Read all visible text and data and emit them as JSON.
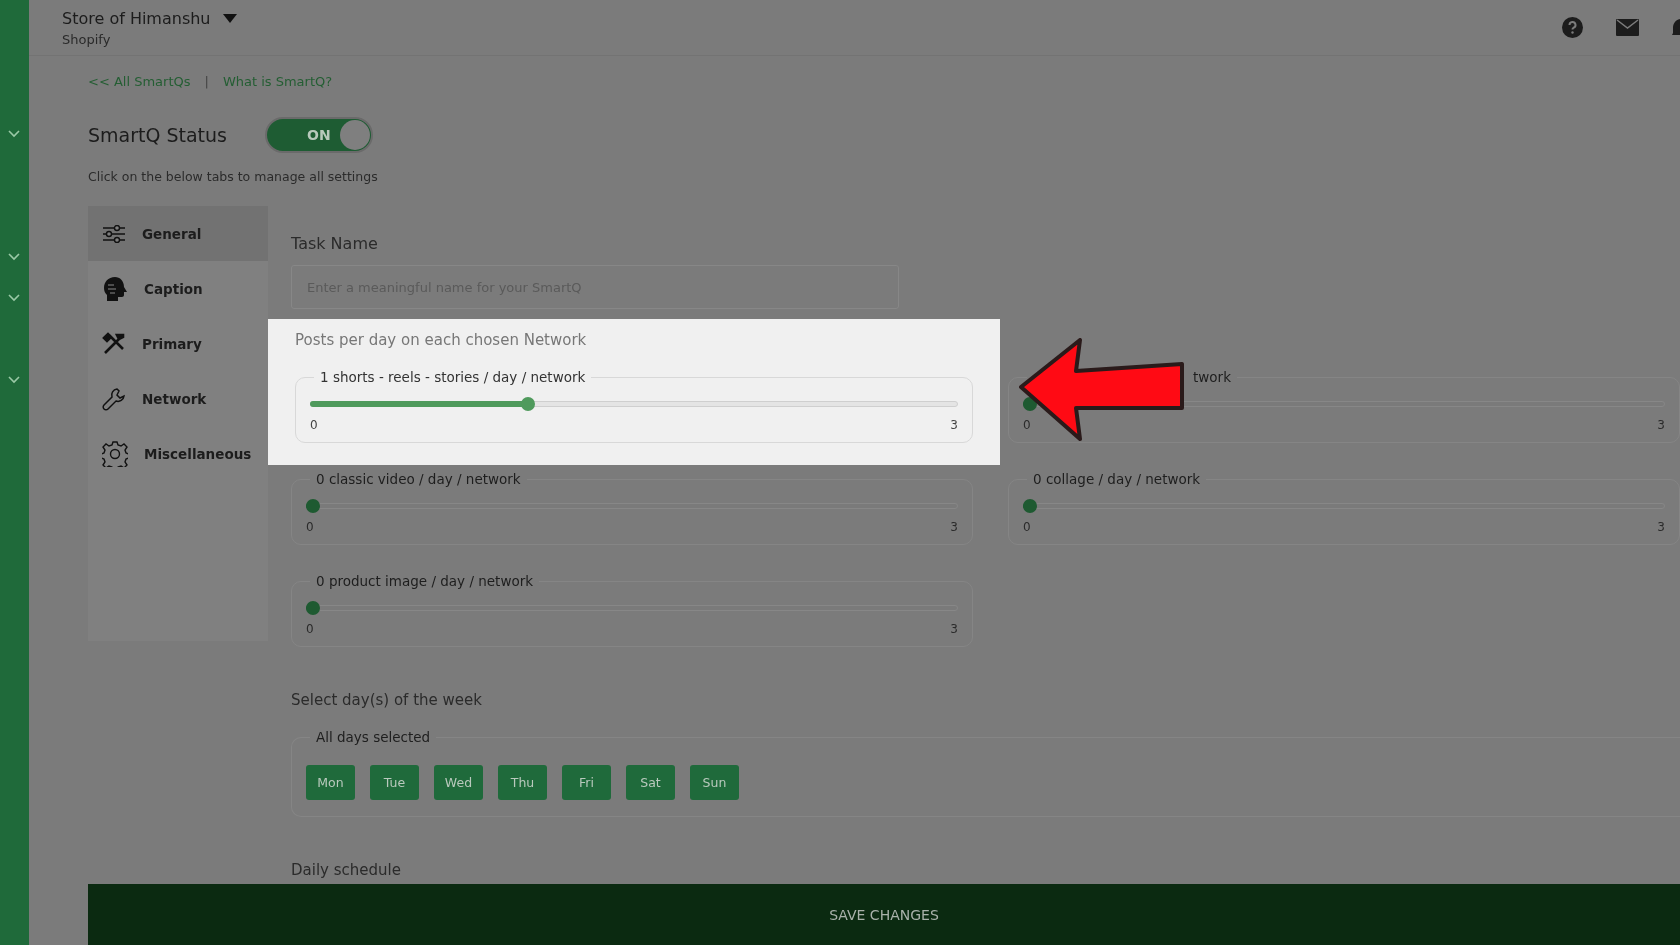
{
  "header": {
    "store": "Store of Himanshu",
    "platform": "Shopify"
  },
  "links": [
    "<< All SmartQs",
    "|",
    "What is SmartQ?"
  ],
  "status": {
    "label": "SmartQ Status",
    "toggle_text": "ON",
    "on": true
  },
  "hint": "Click on the below tabs to manage all settings",
  "menu": [
    {
      "label": "General",
      "kind": "sliders",
      "selected": true
    },
    {
      "label": "Caption",
      "kind": "head",
      "selected": false
    },
    {
      "label": "Primary",
      "kind": "tools",
      "selected": false
    },
    {
      "label": "Network",
      "kind": "wrench",
      "selected": false
    },
    {
      "label": "Miscellaneous",
      "kind": "gear",
      "selected": false
    }
  ],
  "task_name": {
    "label": "Task Name",
    "placeholder": "Enter a meaningful name for your SmartQ"
  },
  "posts": {
    "title": "Posts per day on each chosen Network",
    "highlighted": true,
    "sliders": [
      {
        "label": "1 shorts - reels - stories / day / network",
        "level": 0.3333,
        "min": "0",
        "max": "3"
      },
      {
        "label_end": "twork",
        "level": 0,
        "min": "0",
        "max": "3"
      },
      {
        "label": "0 classic video / day / network",
        "level": 0,
        "min": "0",
        "max": "3"
      },
      {
        "label": "0 collage / day / network",
        "level": 0,
        "min": "0",
        "max": "3"
      },
      {
        "label": "0 product image / day / network",
        "level": 0,
        "min": "0",
        "max": "3"
      }
    ]
  },
  "days": {
    "title": "Select day(s) of the week",
    "legend": "All days selected",
    "items": [
      {
        "label": "Mon",
        "selected": true
      },
      {
        "label": "Tue",
        "selected": true
      },
      {
        "label": "Wed",
        "selected": true
      },
      {
        "label": "Thu",
        "selected": true
      },
      {
        "label": "Fri",
        "selected": true
      },
      {
        "label": "Sat",
        "selected": true
      },
      {
        "label": "Sun",
        "selected": true
      }
    ]
  },
  "daily_schedule": "Daily schedule",
  "save": "SAVE CHANGES"
}
